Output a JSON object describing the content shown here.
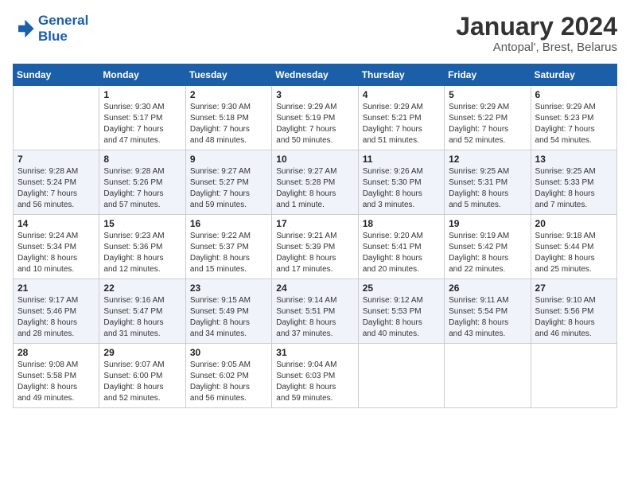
{
  "header": {
    "logo_line1": "General",
    "logo_line2": "Blue",
    "main_title": "January 2024",
    "subtitle": "Antopal', Brest, Belarus"
  },
  "days_of_week": [
    "Sunday",
    "Monday",
    "Tuesday",
    "Wednesday",
    "Thursday",
    "Friday",
    "Saturday"
  ],
  "weeks": [
    [
      {
        "day": "",
        "info": ""
      },
      {
        "day": "1",
        "info": "Sunrise: 9:30 AM\nSunset: 5:17 PM\nDaylight: 7 hours\nand 47 minutes."
      },
      {
        "day": "2",
        "info": "Sunrise: 9:30 AM\nSunset: 5:18 PM\nDaylight: 7 hours\nand 48 minutes."
      },
      {
        "day": "3",
        "info": "Sunrise: 9:29 AM\nSunset: 5:19 PM\nDaylight: 7 hours\nand 50 minutes."
      },
      {
        "day": "4",
        "info": "Sunrise: 9:29 AM\nSunset: 5:21 PM\nDaylight: 7 hours\nand 51 minutes."
      },
      {
        "day": "5",
        "info": "Sunrise: 9:29 AM\nSunset: 5:22 PM\nDaylight: 7 hours\nand 52 minutes."
      },
      {
        "day": "6",
        "info": "Sunrise: 9:29 AM\nSunset: 5:23 PM\nDaylight: 7 hours\nand 54 minutes."
      }
    ],
    [
      {
        "day": "7",
        "info": "Sunrise: 9:28 AM\nSunset: 5:24 PM\nDaylight: 7 hours\nand 56 minutes."
      },
      {
        "day": "8",
        "info": "Sunrise: 9:28 AM\nSunset: 5:26 PM\nDaylight: 7 hours\nand 57 minutes."
      },
      {
        "day": "9",
        "info": "Sunrise: 9:27 AM\nSunset: 5:27 PM\nDaylight: 7 hours\nand 59 minutes."
      },
      {
        "day": "10",
        "info": "Sunrise: 9:27 AM\nSunset: 5:28 PM\nDaylight: 8 hours\nand 1 minute."
      },
      {
        "day": "11",
        "info": "Sunrise: 9:26 AM\nSunset: 5:30 PM\nDaylight: 8 hours\nand 3 minutes."
      },
      {
        "day": "12",
        "info": "Sunrise: 9:25 AM\nSunset: 5:31 PM\nDaylight: 8 hours\nand 5 minutes."
      },
      {
        "day": "13",
        "info": "Sunrise: 9:25 AM\nSunset: 5:33 PM\nDaylight: 8 hours\nand 7 minutes."
      }
    ],
    [
      {
        "day": "14",
        "info": "Sunrise: 9:24 AM\nSunset: 5:34 PM\nDaylight: 8 hours\nand 10 minutes."
      },
      {
        "day": "15",
        "info": "Sunrise: 9:23 AM\nSunset: 5:36 PM\nDaylight: 8 hours\nand 12 minutes."
      },
      {
        "day": "16",
        "info": "Sunrise: 9:22 AM\nSunset: 5:37 PM\nDaylight: 8 hours\nand 15 minutes."
      },
      {
        "day": "17",
        "info": "Sunrise: 9:21 AM\nSunset: 5:39 PM\nDaylight: 8 hours\nand 17 minutes."
      },
      {
        "day": "18",
        "info": "Sunrise: 9:20 AM\nSunset: 5:41 PM\nDaylight: 8 hours\nand 20 minutes."
      },
      {
        "day": "19",
        "info": "Sunrise: 9:19 AM\nSunset: 5:42 PM\nDaylight: 8 hours\nand 22 minutes."
      },
      {
        "day": "20",
        "info": "Sunrise: 9:18 AM\nSunset: 5:44 PM\nDaylight: 8 hours\nand 25 minutes."
      }
    ],
    [
      {
        "day": "21",
        "info": "Sunrise: 9:17 AM\nSunset: 5:46 PM\nDaylight: 8 hours\nand 28 minutes."
      },
      {
        "day": "22",
        "info": "Sunrise: 9:16 AM\nSunset: 5:47 PM\nDaylight: 8 hours\nand 31 minutes."
      },
      {
        "day": "23",
        "info": "Sunrise: 9:15 AM\nSunset: 5:49 PM\nDaylight: 8 hours\nand 34 minutes."
      },
      {
        "day": "24",
        "info": "Sunrise: 9:14 AM\nSunset: 5:51 PM\nDaylight: 8 hours\nand 37 minutes."
      },
      {
        "day": "25",
        "info": "Sunrise: 9:12 AM\nSunset: 5:53 PM\nDaylight: 8 hours\nand 40 minutes."
      },
      {
        "day": "26",
        "info": "Sunrise: 9:11 AM\nSunset: 5:54 PM\nDaylight: 8 hours\nand 43 minutes."
      },
      {
        "day": "27",
        "info": "Sunrise: 9:10 AM\nSunset: 5:56 PM\nDaylight: 8 hours\nand 46 minutes."
      }
    ],
    [
      {
        "day": "28",
        "info": "Sunrise: 9:08 AM\nSunset: 5:58 PM\nDaylight: 8 hours\nand 49 minutes."
      },
      {
        "day": "29",
        "info": "Sunrise: 9:07 AM\nSunset: 6:00 PM\nDaylight: 8 hours\nand 52 minutes."
      },
      {
        "day": "30",
        "info": "Sunrise: 9:05 AM\nSunset: 6:02 PM\nDaylight: 8 hours\nand 56 minutes."
      },
      {
        "day": "31",
        "info": "Sunrise: 9:04 AM\nSunset: 6:03 PM\nDaylight: 8 hours\nand 59 minutes."
      },
      {
        "day": "",
        "info": ""
      },
      {
        "day": "",
        "info": ""
      },
      {
        "day": "",
        "info": ""
      }
    ]
  ]
}
